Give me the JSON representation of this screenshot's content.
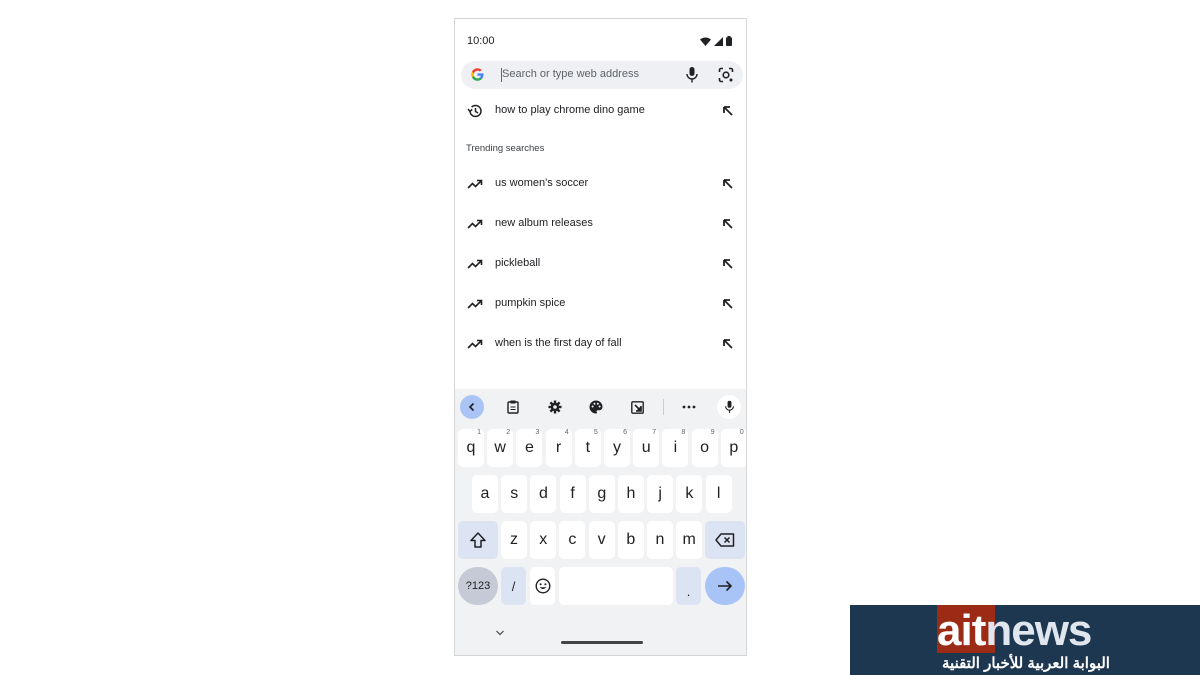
{
  "status_bar": {
    "time": "10:00",
    "icons": [
      "wifi-icon",
      "signal-icon",
      "battery-icon"
    ]
  },
  "omnibox": {
    "placeholder": "Search or type web address",
    "value": ""
  },
  "history": [
    {
      "text": "how to play chrome dino game",
      "icon": "history-icon"
    }
  ],
  "trending": {
    "heading": "Trending searches",
    "items": [
      {
        "text": "us women's soccer"
      },
      {
        "text": "new album releases"
      },
      {
        "text": "pickleball"
      },
      {
        "text": "pumpkin spice"
      },
      {
        "text": "when is the first day of fall"
      }
    ]
  },
  "keyboard": {
    "toolbar": [
      "back-icon",
      "clipboard-icon",
      "settings-icon",
      "palette-icon",
      "resize-icon",
      "more-icon",
      "mic-icon"
    ],
    "row1": [
      {
        "k": "q",
        "h": "1"
      },
      {
        "k": "w",
        "h": "2"
      },
      {
        "k": "e",
        "h": "3"
      },
      {
        "k": "r",
        "h": "4"
      },
      {
        "k": "t",
        "h": "5"
      },
      {
        "k": "y",
        "h": "6"
      },
      {
        "k": "u",
        "h": "7"
      },
      {
        "k": "i",
        "h": "8"
      },
      {
        "k": "o",
        "h": "9"
      },
      {
        "k": "p",
        "h": "0"
      }
    ],
    "row2": [
      "a",
      "s",
      "d",
      "f",
      "g",
      "h",
      "j",
      "k",
      "l"
    ],
    "row3": [
      "z",
      "x",
      "c",
      "v",
      "b",
      "n",
      "m"
    ],
    "symbols_label": "?123",
    "slash_label": "/",
    "period_label": "."
  },
  "watermark": {
    "brand_a": "ait",
    "brand_b": "news",
    "tagline": "البوابة العربية للأخبار التقنية"
  },
  "colors": {
    "accent": "#1a73e8",
    "enter_key": "#a8c3f6",
    "logo_bg": "#1e3751",
    "logo_red": "#9c2b15"
  }
}
